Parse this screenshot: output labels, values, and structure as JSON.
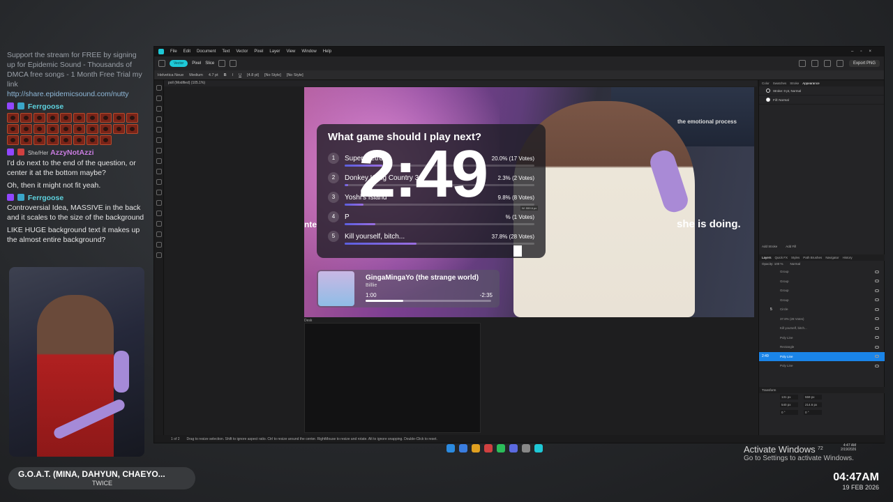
{
  "chat": {
    "promo": "Support the stream for FREE by signing up for Epidemic Sound - Thousands of DMCA free songs - 1 Month Free Trial my link",
    "promo_link": "http://share.epidemicsound.com/nutty",
    "messages": [
      {
        "user": "Ferrgoose",
        "text": ""
      },
      {
        "user": "AzzyNotAzzi",
        "pronoun": "She/Her",
        "text": "I'd do next to the end of the question, or center it at the bottom maybe?"
      },
      {
        "user": "",
        "text": "Oh, then it might not fit yeah."
      },
      {
        "user": "Ferrgoose",
        "text": "Controversial Idea, MASSIVE in the back and it scales to the size of the background"
      },
      {
        "user": "",
        "text": "LIKE HUGE background text it makes up the almost entire background?"
      }
    ]
  },
  "now_playing": {
    "title": "G.O.A.T. (MINA, DAHYUN, CHAEYO...",
    "artist": "TWICE"
  },
  "clock": {
    "time": "04:47AM",
    "date": "19 FEB 2026"
  },
  "app": {
    "menu": [
      "File",
      "Edit",
      "Document",
      "Text",
      "Vector",
      "Pixel",
      "Layer",
      "View",
      "Window",
      "Help"
    ],
    "persona": {
      "vector": "Vector",
      "pixel": "Pixel",
      "slice": "Slice"
    },
    "export": "Export PNG",
    "ctx": {
      "font": "Helvetica Neue",
      "weight": "Medium",
      "size": "4.7 pt",
      "leading": "[4.8 pt]",
      "style1": "[No Style]",
      "style2": "[No Style]"
    },
    "doc_tab": "poll (Modified) (105.1%)",
    "right_tabs": [
      "Color",
      "Swatches",
      "Stroke",
      "Appearance"
    ],
    "appearance": [
      {
        "label": "Stroke: 0 pt, Normal"
      },
      {
        "label": "Fill: Normal"
      }
    ],
    "add_stroke": "Add Stroke",
    "add_fill": "Add Fill",
    "layer_tabs": [
      "Layers",
      "Quick FX",
      "Styles",
      "Path Brushes",
      "Navigator",
      "History"
    ],
    "opacity": "Opacity: 100 %",
    "blend": "Normal",
    "layers": [
      {
        "name": "Group"
      },
      {
        "name": "Group"
      },
      {
        "name": "Group"
      },
      {
        "name": "Group"
      },
      {
        "name": "Circle",
        "thumb": "5"
      },
      {
        "name": "37.8% (28 Votes)"
      },
      {
        "name": "Kill yourself, bitch..."
      },
      {
        "name": "Poly Line"
      },
      {
        "name": "Rectangle"
      },
      {
        "name": "Poly Line",
        "selected_thumb": "2:49"
      },
      {
        "name": "Poly Line"
      }
    ],
    "transform_title": "Transform",
    "transform": {
      "x": "131 px",
      "y": "540 px",
      "w": "559 px",
      "h": "214.6 px",
      "r": "0 °",
      "s": "0 °"
    },
    "desk": "Desk",
    "status": "Drag to resize selection. Shift to ignore aspect ratio. Ctrl to resize around the center. RightMouse to resize and rotate. Alt to ignore snapping. Double-Click to reset.",
    "page": "1 of 2"
  },
  "poll": {
    "title": "What game should I play next?",
    "options": [
      {
        "num": "1",
        "label": "Super Metroid",
        "pct": "20.0% (17 Votes)",
        "share": 0.2
      },
      {
        "num": "2",
        "label": "Donkey Kong Country 3",
        "pct": "2.3% (2 Votes)",
        "share": 0.02
      },
      {
        "num": "3",
        "label": "Yoshi's Island",
        "pct": "9.8% (8 Votes)",
        "share": 0.1
      },
      {
        "num": "4",
        "label": "P",
        "pct": "% (1 Votes)",
        "share": 0.16
      },
      {
        "num": "5",
        "label": "Kill yourself, bitch...",
        "pct": "37.8% (28 Votes)",
        "share": 0.38
      }
    ],
    "timer": "2:49",
    "dimension": "W: 559.6 px"
  },
  "captions": {
    "right": "she is doing.",
    "top": "the emotional process",
    "left": "nte"
  },
  "player": {
    "song": "GingaMingaYo (the strange world)",
    "artist": "Billlie",
    "elapsed": "1:00",
    "remaining": "-2:35",
    "progress": 0.3
  },
  "activate": {
    "title": "Activate Windows",
    "subtitle": "Go to Settings to activate Windows."
  },
  "sys_time": {
    "time": "4:47 AM",
    "date": "2/19/2026",
    "extra": "72"
  }
}
